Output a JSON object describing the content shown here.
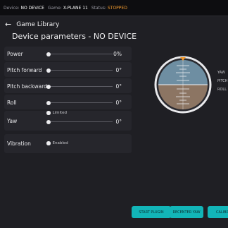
{
  "status_bar": {
    "device_label": "Device:",
    "device_value": "NO DEVICE",
    "game_label": "Game:",
    "game_value": "X-PLANE 11",
    "status_label": "Status:",
    "status_value": "STOPPED",
    "status_color": "#f29a2e"
  },
  "nav": {
    "back_icon": "arrow-left-icon",
    "back_label": "Game Library"
  },
  "page_title": "Device parameters - NO DEVICE",
  "parameters": [
    {
      "label": "Power",
      "value": "0%",
      "level": 0
    },
    {
      "label": "Pitch forward",
      "value": "0°",
      "level": 0
    },
    {
      "label": "Pitch backward",
      "value": "0°",
      "level": 0
    },
    {
      "label": "Roll",
      "value": "0°",
      "level": 0
    },
    {
      "label": "Yaw",
      "value": "0°",
      "level": 0,
      "option_label": "Limited"
    }
  ],
  "vibration": {
    "label": "Vibration",
    "toggle_label": "Enabled"
  },
  "attitude_indicator": {
    "legend": [
      "YAW",
      "PITCH",
      "ROLL"
    ],
    "sky_color": "#6e8ea2",
    "ground_color": "#8c7563",
    "marker_color": "#f29a2e"
  },
  "buttons": {
    "start_plugin": "START PLUGIN",
    "recenter_yaw": "RECENTER YAW",
    "calibrate": "CALIBRA"
  },
  "accent_color": "#12b5b8"
}
